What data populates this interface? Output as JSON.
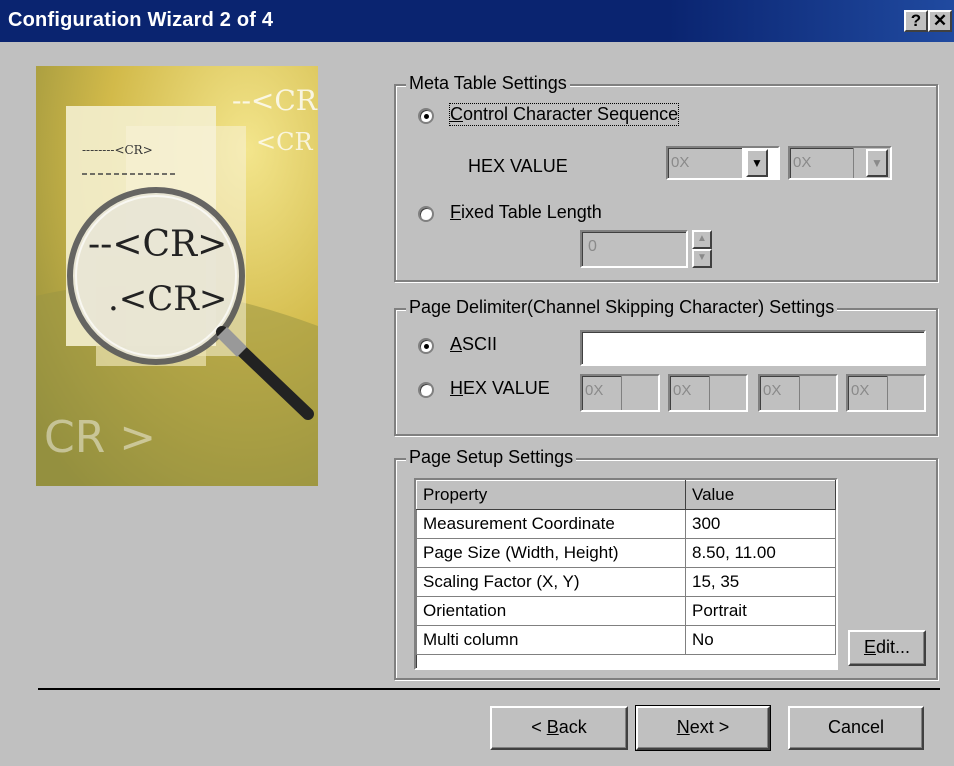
{
  "window": {
    "title": "Configuration Wizard 2 of 4",
    "help_glyph": "?",
    "close_glyph": "✕"
  },
  "illustration": {
    "icon": "magnifier-over-document-icon",
    "texts": [
      "--<CR",
      "<CR",
      "--------<CR>",
      "--<CR>",
      ".<CR>",
      "CR >"
    ]
  },
  "meta_table": {
    "legend": "Meta Table Settings",
    "option_control": "Control Character Sequence",
    "hex_label": "HEX VALUE",
    "hex1_prefix": "0X",
    "hex2_prefix": "0X",
    "option_fixed": "Fixed Table Length",
    "fixed_value": "0",
    "selected": "control"
  },
  "page_delimiter": {
    "legend": "Page Delimiter(Channel Skipping Character) Settings",
    "option_ascii": "ASCII",
    "ascii_value": "",
    "option_hex": "HEX VALUE",
    "hex_prefixes": [
      "0X",
      "0X",
      "0X",
      "0X"
    ],
    "selected": "ascii"
  },
  "page_setup": {
    "legend": "Page Setup Settings",
    "columns": [
      "Property",
      "Value"
    ],
    "rows": [
      [
        "Measurement Coordinate",
        "300"
      ],
      [
        "Page Size (Width, Height)",
        "8.50, 11.00"
      ],
      [
        "Scaling Factor (X, Y)",
        "15, 35"
      ],
      [
        "Orientation",
        "Portrait"
      ],
      [
        "Multi column",
        "No"
      ]
    ],
    "edit_button": "Edit..."
  },
  "footer": {
    "back": "< Back",
    "next": "Next >",
    "cancel": "Cancel"
  }
}
